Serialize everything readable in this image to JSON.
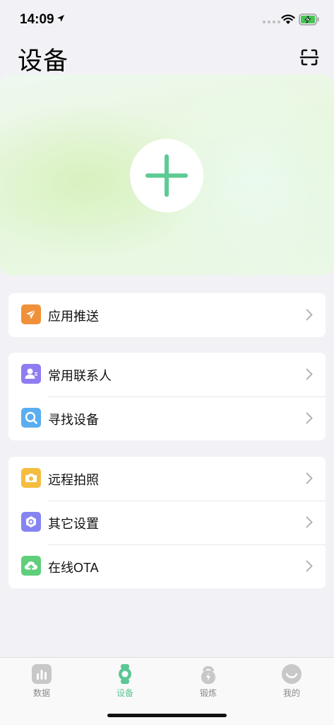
{
  "status_bar": {
    "time": "14:09"
  },
  "header": {
    "title": "设备"
  },
  "groups": [
    {
      "items": [
        {
          "label": "应用推送",
          "icon": "paper-plane-icon",
          "color": "#f0913a"
        }
      ]
    },
    {
      "items": [
        {
          "label": "常用联系人",
          "icon": "contact-icon",
          "color": "#8e7cf3"
        },
        {
          "label": "寻找设备",
          "icon": "magnifier-icon",
          "color": "#5aaef0"
        }
      ]
    },
    {
      "items": [
        {
          "label": "远程拍照",
          "icon": "camera-icon",
          "color": "#f5bd3f"
        },
        {
          "label": "其它设置",
          "icon": "hexagon-settings-icon",
          "color": "#8584f2"
        },
        {
          "label": "在线OTA",
          "icon": "cloud-upload-icon",
          "color": "#5fcf7b"
        }
      ]
    }
  ],
  "tabs": [
    {
      "label": "数据",
      "icon": "chart-icon",
      "active": false
    },
    {
      "label": "设备",
      "icon": "watch-icon",
      "active": true
    },
    {
      "label": "锻炼",
      "icon": "kettlebell-icon",
      "active": false
    },
    {
      "label": "我的",
      "icon": "smile-icon",
      "active": false
    }
  ],
  "colors": {
    "accent": "#5ac794",
    "background": "#f2f2f6"
  }
}
